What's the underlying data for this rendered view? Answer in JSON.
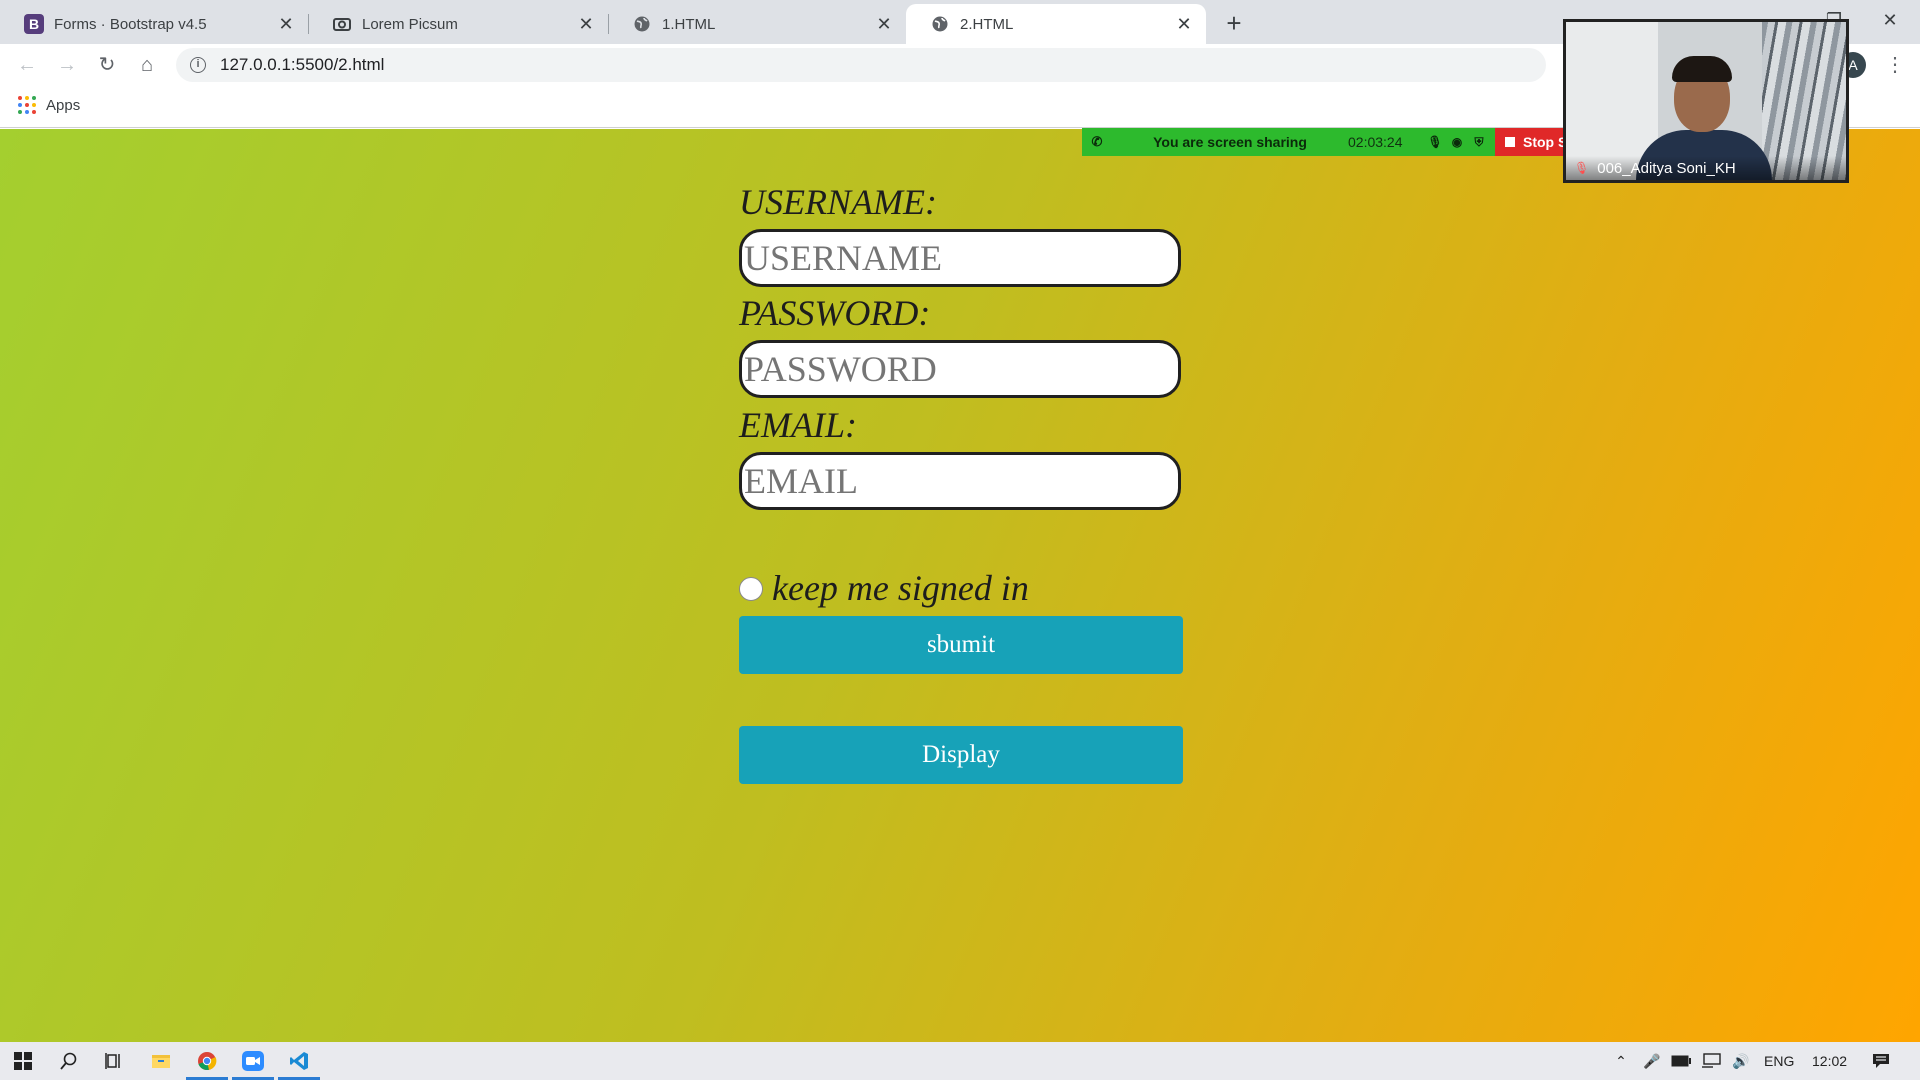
{
  "browser": {
    "tabs": [
      {
        "title": "Forms · Bootstrap v4.5",
        "favicon": "bootstrap-icon",
        "active": false
      },
      {
        "title": "Lorem Picsum",
        "favicon": "camera-icon",
        "active": false
      },
      {
        "title": "1.HTML",
        "favicon": "globe-icon",
        "active": false
      },
      {
        "title": "2.HTML",
        "favicon": "globe-icon",
        "active": true
      }
    ],
    "address": "127.0.0.1:5500/2.html",
    "profile_initial": "A",
    "bookmarks": {
      "apps_label": "Apps"
    }
  },
  "form": {
    "username_label": "USERNAME:",
    "username_placeholder": "USERNAME",
    "password_label": "PASSWORD:",
    "password_placeholder": "PASSWORD",
    "email_label": "EMAIL:",
    "email_placeholder": "EMAIL",
    "keep_signed_in": "keep me signed in",
    "submit_label": "sbumit",
    "display_label": "Display"
  },
  "zoom": {
    "sharing_message": "You are screen sharing",
    "elapsed": "02:03:24",
    "stop_share_label": "Stop Share",
    "participant_name": "006_Aditya Soni_KH"
  },
  "taskbar": {
    "language": "ENG",
    "clock": "12:02"
  },
  "colors": {
    "button": "#17a2b8",
    "gradient_start": "#a4cf2f",
    "gradient_end": "#ffa500",
    "share_bar": "#2dba2d",
    "stop_share": "#e02828"
  }
}
